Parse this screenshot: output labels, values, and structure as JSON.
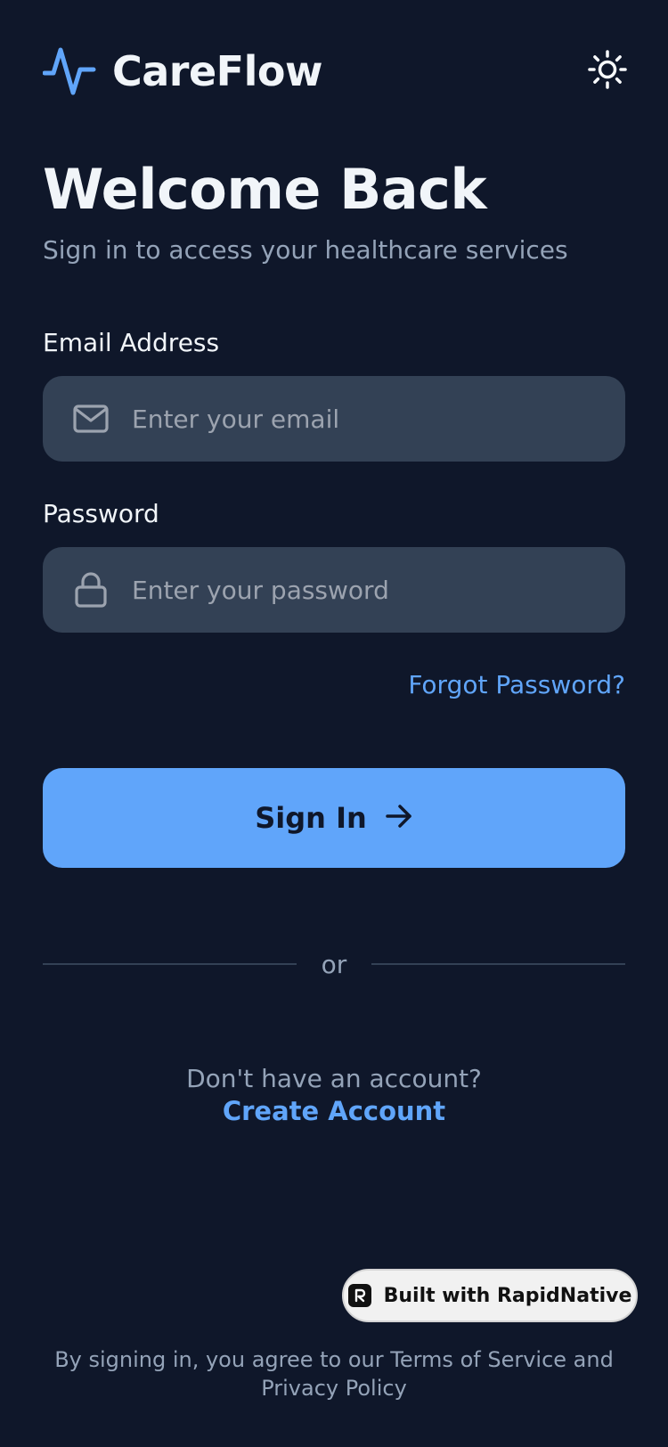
{
  "app": {
    "name": "CareFlow",
    "accent_color": "#60a5fa",
    "background_color": "#0f172a",
    "logo_icon": "pulse-icon",
    "theme_toggle_icon": "sun-icon"
  },
  "welcome": {
    "title": "Welcome Back",
    "subtitle": "Sign in to access your healthcare services"
  },
  "form": {
    "email": {
      "label": "Email Address",
      "placeholder": "Enter your email",
      "value": "",
      "icon": "mail-icon"
    },
    "password": {
      "label": "Password",
      "placeholder": "Enter your password",
      "value": "",
      "icon": "lock-icon"
    },
    "forgot_password": "Forgot Password?",
    "submit_label": "Sign In",
    "submit_icon": "arrow-right-icon"
  },
  "divider": {
    "text": "or"
  },
  "signup": {
    "prompt": "Don't have an account?",
    "link": "Create Account"
  },
  "badge": {
    "label": "Built with RapidNative",
    "icon": "rapidnative-logo-icon"
  },
  "footer": {
    "terms_line1": "By signing in, you agree to our Terms of Service and",
    "terms_line2": "Privacy Policy"
  }
}
